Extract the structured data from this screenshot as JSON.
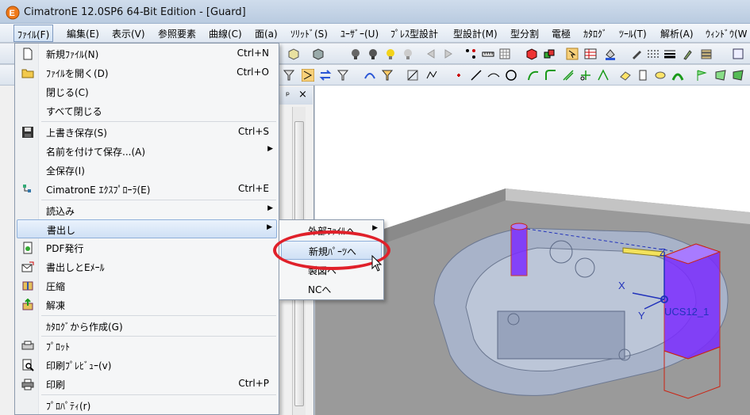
{
  "window": {
    "title": "CimatronE 12.0SP6  64-Bit Edition - [Guard]",
    "icon": "cimatron-app-icon"
  },
  "menubar": [
    {
      "label": "ﾌｧｲﾙ(F)",
      "active": true
    },
    {
      "label": "編集(E)"
    },
    {
      "label": "表示(V)"
    },
    {
      "label": "参照要素"
    },
    {
      "label": "曲線(C)"
    },
    {
      "label": "面(a)"
    },
    {
      "label": "ｿﾘｯﾄﾞ(S)"
    },
    {
      "label": "ﾕｰｻﾞｰ(U)"
    },
    {
      "label": "ﾌﾟﾚｽ型設計"
    },
    {
      "label": "型設計(M)"
    },
    {
      "label": "型分割"
    },
    {
      "label": "電極"
    },
    {
      "label": "ｶﾀﾛｸﾞ"
    },
    {
      "label": "ﾂｰﾙ(T)"
    },
    {
      "label": "解析(A)"
    },
    {
      "label": "ｳｨﾝﾄﾞｳ(W"
    }
  ],
  "file_menu": {
    "items": [
      {
        "label": "新規ﾌｧｲﾙ(N)",
        "shortcut": "Ctrl+N",
        "icon": "new-file-icon"
      },
      {
        "label": "ﾌｧｲﾙを開く(D)",
        "shortcut": "Ctrl+O",
        "icon": "open-folder-icon"
      },
      {
        "label": "閉じる(C)"
      },
      {
        "label": "すべて閉じる"
      },
      {
        "label": "上書き保存(S)",
        "shortcut": "Ctrl+S",
        "icon": "save-icon"
      },
      {
        "label": "名前を付けて保存...(A)",
        "submenu": true
      },
      {
        "label": "全保存(I)"
      },
      {
        "label": "CimatronE ｴｸｽﾌﾟﾛｰﾗ(E)",
        "shortcut": "Ctrl+E",
        "icon": "explorer-icon"
      },
      {
        "label": "読込み",
        "submenu": true
      },
      {
        "label": "書出し",
        "submenu": true,
        "highlighted": true
      },
      {
        "label": "PDF発行",
        "icon": "pdf-publish-icon"
      },
      {
        "label": "書出しとEﾒｰﾙ",
        "icon": "export-mail-icon"
      },
      {
        "label": "圧縮",
        "icon": "compress-icon"
      },
      {
        "label": "解凍",
        "icon": "extract-icon"
      },
      {
        "label": "ｶﾀﾛｸﾞから作成(G)"
      },
      {
        "label": "ﾌﾟﾛｯﾄ",
        "icon": "plot-icon"
      },
      {
        "label": "印刷ﾌﾟﾚﾋﾞｭｰ(v)",
        "icon": "print-preview-icon"
      },
      {
        "label": "印刷",
        "shortcut": "Ctrl+P",
        "icon": "print-icon"
      },
      {
        "label": "ﾌﾟﾛﾊﾟﾃｨ(r)"
      }
    ]
  },
  "export_submenu": {
    "items": [
      {
        "label": "外部ﾌｧｲﾙへ",
        "submenu": true
      },
      {
        "label": "新規ﾊﾟｰﾂへ",
        "highlighted": true,
        "circled": true
      },
      {
        "label": "製図へ"
      },
      {
        "label": "NCへ"
      }
    ]
  },
  "panel": {
    "pin_label": "ᵖ",
    "close_label": "×"
  },
  "viewport_labels": {
    "x_axis": "X",
    "y_axis": "Y",
    "z_axis": "Z",
    "ucs_name": "UCS12_1"
  },
  "colors": {
    "highlight": "#cfe0f5",
    "annotation": "#e0202a",
    "selection": "#7b2cff"
  }
}
